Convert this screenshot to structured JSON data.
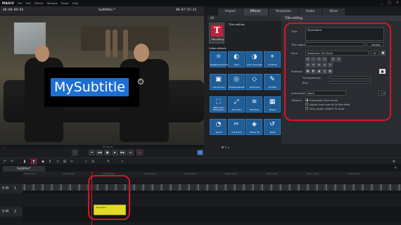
{
  "app": {
    "logo": "MAGIX",
    "menu": [
      "File",
      "Edit",
      "Effects",
      "Window",
      "Share",
      "Help"
    ],
    "window_controls": [
      "_",
      "□",
      "×"
    ]
  },
  "player": {
    "timecode_left": "00:00:09:04",
    "title": "Subtitles *",
    "timecode_right": "00:07:55:24",
    "subtitle_text": "MySubtitle",
    "position_readout": "07:33:24"
  },
  "tabs": [
    "Import",
    "Effects",
    "Templates",
    "Audio",
    "Store"
  ],
  "active_tab": "Effects",
  "effects_panel": {
    "header": "All",
    "title_editing_label": "Title editing",
    "title_editing_card": "Title editing",
    "video_effects_label": "Video effects",
    "tiles": [
      {
        "label": "Brightness/Contrast",
        "icon": "☼"
      },
      {
        "label": "Color",
        "icon": "◐"
      },
      {
        "label": "Color correction",
        "icon": "◑"
      },
      {
        "label": "Locations",
        "icon": "⌖"
      },
      {
        "label": "Chroma key",
        "icon": "▣"
      },
      {
        "label": "Miniatureplanet",
        "icon": "◎"
      },
      {
        "label": "Sharpness",
        "icon": "◇"
      },
      {
        "label": "Art filter",
        "icon": "✎"
      },
      {
        "label": "NEW Video Stabilization",
        "icon": "⛶"
      },
      {
        "label": "Zoom/Pan",
        "icon": "⤢"
      },
      {
        "label": "Distortion",
        "icon": "≋"
      },
      {
        "label": "Mosaic",
        "icon": "▦"
      },
      {
        "label": "Speed",
        "icon": "◔"
      },
      {
        "label": "Cut & Trim",
        "icon": "✂"
      },
      {
        "label": "Stereo 3D",
        "icon": "◈"
      },
      {
        "label": "Reset",
        "icon": "↺"
      }
    ]
  },
  "title_editing": {
    "header": "Title editing",
    "title_label": "Title:",
    "title_value": "MySubtitle",
    "title_object_label": "Title object",
    "title_object_value": "",
    "delete_label": "Delete",
    "font_label": "Font:",
    "font_value": "Bookman Old Style",
    "font_size": "10",
    "format_buttons": [
      "B",
      "I",
      "U",
      "S",
      "A",
      "A"
    ],
    "align_buttons": [
      "≡",
      "≡",
      "≡",
      "▭",
      "▭"
    ],
    "shadow_label": "Shadow:",
    "transparency_label": "Transparency:",
    "blur_label": "Blur:",
    "animation_label": "Animation:",
    "animation_value": "None",
    "animation_duration": "1.5",
    "options_label": "Options:",
    "options": [
      {
        "label": "Automatic text break",
        "checked": true
      },
      {
        "label": "Adjust font size to fit title field",
        "checked": false
      },
      {
        "label": "Only apply visible TV area",
        "checked": false
      }
    ]
  },
  "timeline": {
    "project_tab": "Subtitles*",
    "ruler_labels": [
      "00:00:00:00",
      "00:00:10:00",
      "00:00:20:00",
      "00:00:30:00",
      "00:00:40:00",
      "00:00:50:00",
      "00:01:00:00",
      "00:01:10:00",
      "00:01:20:00"
    ],
    "tracks": [
      {
        "letters": "S M",
        "num": "1"
      },
      {
        "letters": "S M",
        "num": "2"
      }
    ],
    "clip_label": "MySubtitle"
  },
  "colors": {
    "accent_red": "#d1182a",
    "subtitle_bg": "#1d6fd1",
    "title_clip": "#e3d92a",
    "effect_tile": "#1f5d97"
  }
}
